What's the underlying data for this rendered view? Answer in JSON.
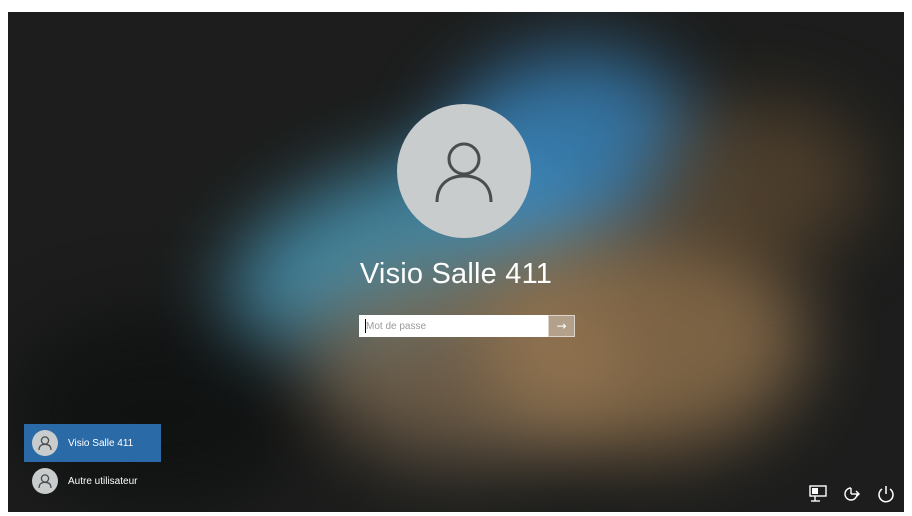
{
  "login": {
    "username": "Visio Salle 411",
    "password_placeholder": "Mot de passe",
    "submit_glyph": "→"
  },
  "user_list": [
    {
      "label": "Visio Salle 411",
      "selected": true
    },
    {
      "label": "Autre utilisateur",
      "selected": false
    }
  ],
  "system_icons": [
    "network-icon",
    "ease-of-access-icon",
    "power-icon"
  ],
  "colors": {
    "selected_user_bg": "#2a6ba7",
    "avatar_bg": "#c9cccd"
  }
}
